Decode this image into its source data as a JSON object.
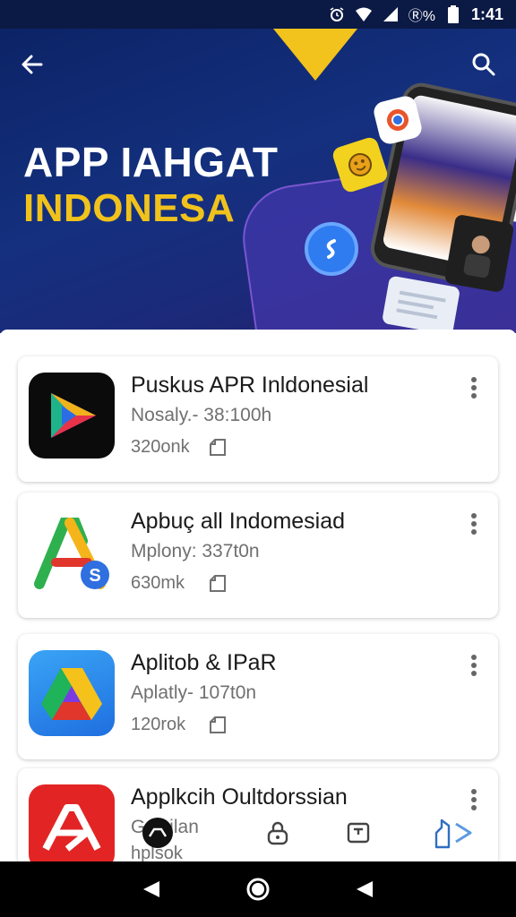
{
  "status_bar": {
    "battery_text": "Ⓡ%",
    "time": "1:41",
    "icons": [
      "alarm-icon",
      "wifi-icon",
      "signal-icon",
      "battery-icon"
    ]
  },
  "hero": {
    "title_line1": "APP IAHGAT",
    "title_line2": "INDONESA",
    "icons": [
      "back-arrow-icon",
      "search-icon"
    ],
    "colors": {
      "background": "#14307e",
      "accent": "#f1c21b"
    }
  },
  "apps": [
    {
      "name": "Puskus APR Inldonesial",
      "subtitle": "Nosaly.- 38:100h",
      "size": "320onk",
      "icon": "colorful-play-triangle-icon"
    },
    {
      "name": "Apbuç all Indomesiad",
      "subtitle": "Mplony: 337t0n",
      "size": "630mk",
      "icon": "letter-a-s-badge-icon"
    },
    {
      "name": "Aplitob & IPaR",
      "subtitle": "Aplatly- 107t0n",
      "size": "120rok",
      "icon": "drive-triangle-icon"
    },
    {
      "name": "Applkcih Oultdorssian",
      "subtitle": "Galcilan",
      "size": "hplsok",
      "icon": "red-abstract-logo-icon"
    }
  ],
  "tab_bar": {
    "items": [
      "home-tab-icon",
      "lock-tab-icon",
      "inbox-tab-icon",
      "share-tab-icon"
    ]
  },
  "nav_bar": {
    "items": [
      "back-triangle-icon",
      "home-circle-icon",
      "recents-triangle-icon"
    ]
  }
}
